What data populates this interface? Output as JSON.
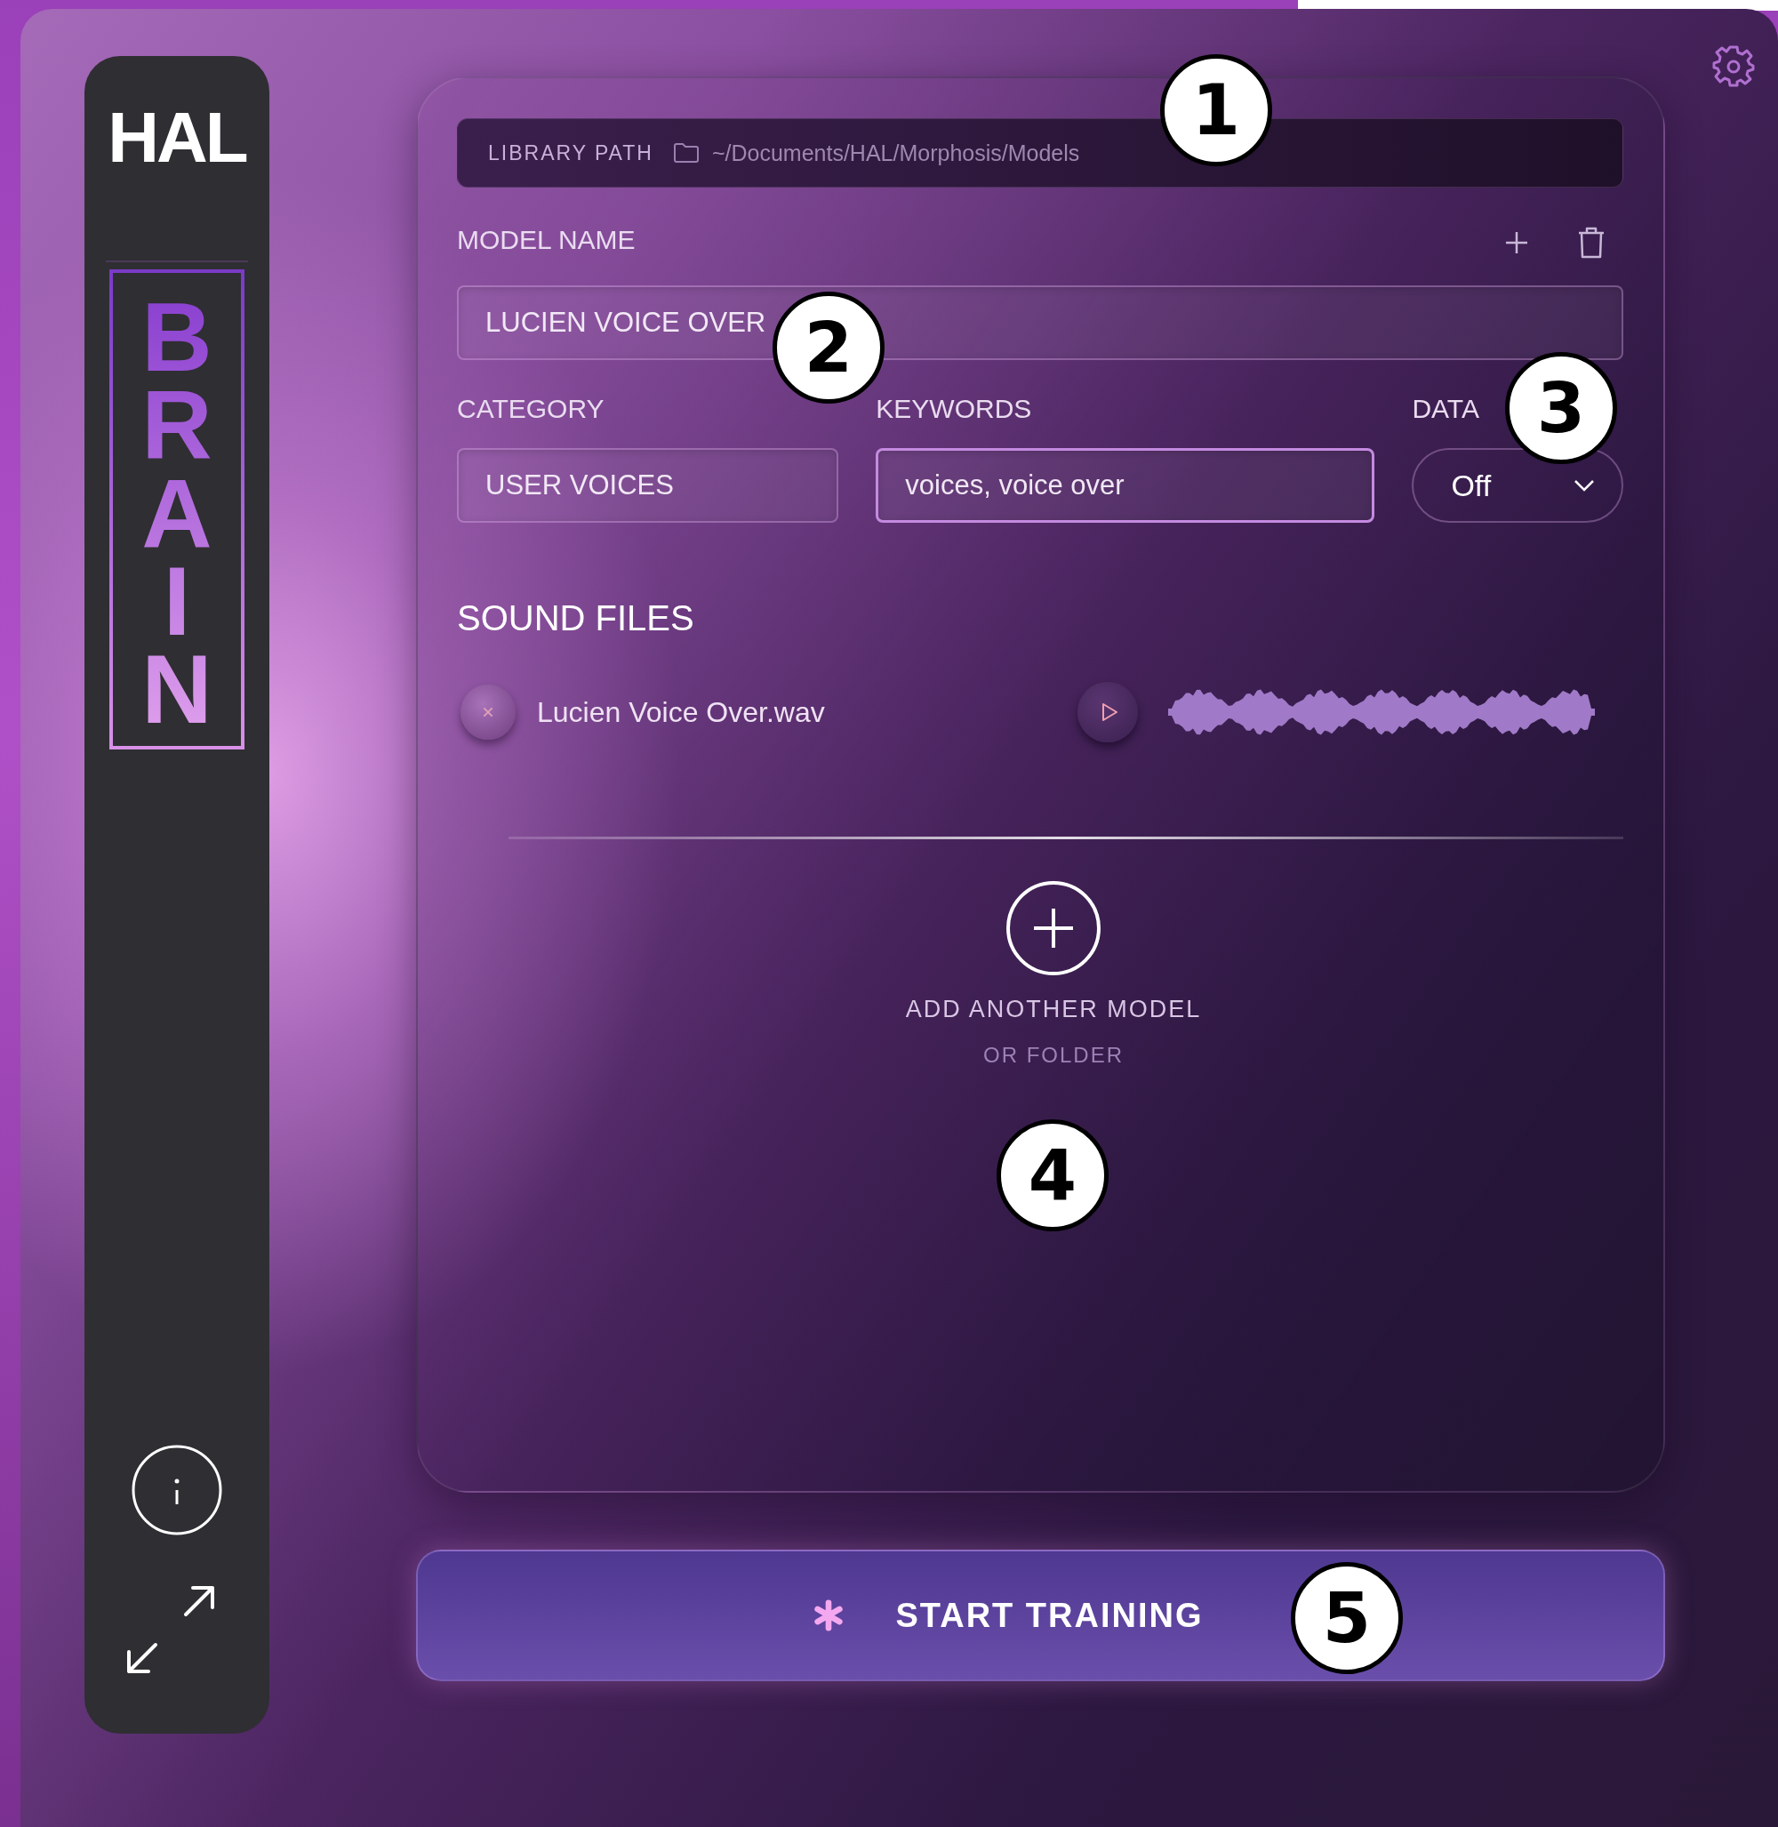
{
  "sidebar": {
    "logo": "HAL",
    "title": "BRAIN"
  },
  "library_path": {
    "label": "LIBRARY PATH",
    "value": "~/Documents/HAL/Morphosis/Models"
  },
  "model_name": {
    "label": "MODEL NAME",
    "value": "LUCIEN VOICE OVER"
  },
  "category": {
    "label": "CATEGORY",
    "value": "USER VOICES"
  },
  "keywords": {
    "label": "KEYWORDS",
    "value": "voices, voice over",
    "focused": true
  },
  "data": {
    "label": "DATA",
    "value": "Off"
  },
  "sound_files": {
    "title": "SOUND FILES",
    "files": [
      {
        "name": "Lucien Voice Over.wav"
      }
    ]
  },
  "add_model": {
    "label": "ADD ANOTHER MODEL",
    "sublabel": "OR FOLDER"
  },
  "start_button": {
    "label": "START TRAINING"
  },
  "callouts": [
    "1",
    "2",
    "3",
    "4",
    "5"
  ]
}
